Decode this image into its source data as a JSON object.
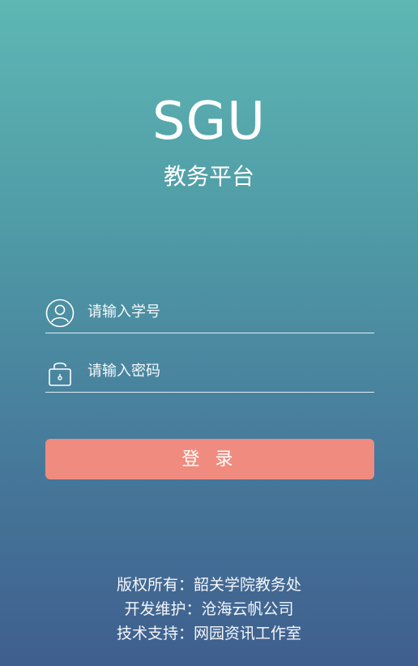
{
  "app": {
    "logo_text": "SGU",
    "subtitle": "教务平台"
  },
  "form": {
    "username": {
      "placeholder": "请输入学号",
      "icon": "user-icon"
    },
    "password": {
      "placeholder": "请输入密码",
      "icon": "lock-icon"
    },
    "login_label": "登 录",
    "login_color": "#f08c7f"
  },
  "footer": {
    "line1": "版权所有：韶关学院教务处",
    "line2": "开发维护：沧海云帆公司",
    "line3": "技术支持：网园资讯工作室"
  },
  "theme": {
    "gradient_top": "#5eb7b3",
    "gradient_bottom": "#3f5f8e"
  }
}
